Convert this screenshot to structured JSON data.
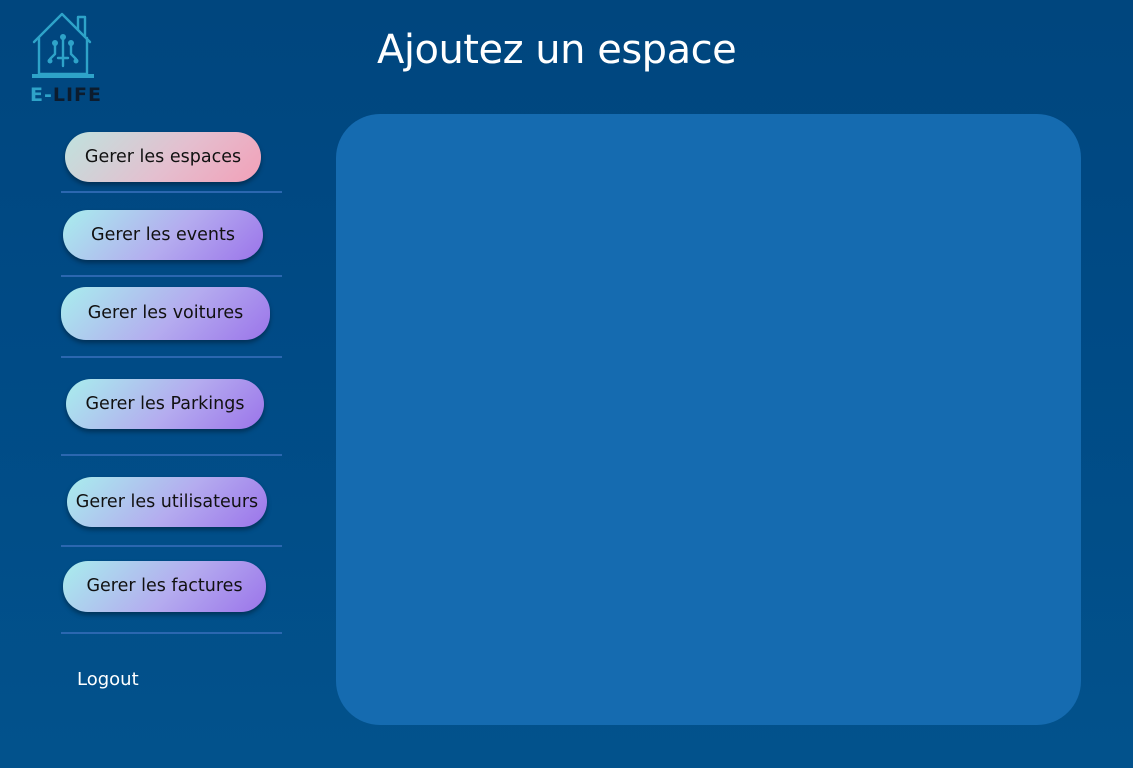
{
  "logo": {
    "prefix": "E-",
    "suffix": "LIFE"
  },
  "header": {
    "title": "Ajoutez un espace"
  },
  "sidebar": {
    "items": [
      {
        "label": "Gerer les espaces",
        "active": true
      },
      {
        "label": "Gerer les events"
      },
      {
        "label": "Gerer les voitures"
      },
      {
        "label": "Gerer les Parkings"
      },
      {
        "label": "Gerer les utilisateurs"
      },
      {
        "label": "Gerer les factures"
      }
    ],
    "logout_label": "Logout"
  },
  "colors": {
    "background": "#00467e",
    "panel": "#156bb0",
    "divider": "#2b67b0",
    "logo_accent": "#2ea3c9"
  }
}
